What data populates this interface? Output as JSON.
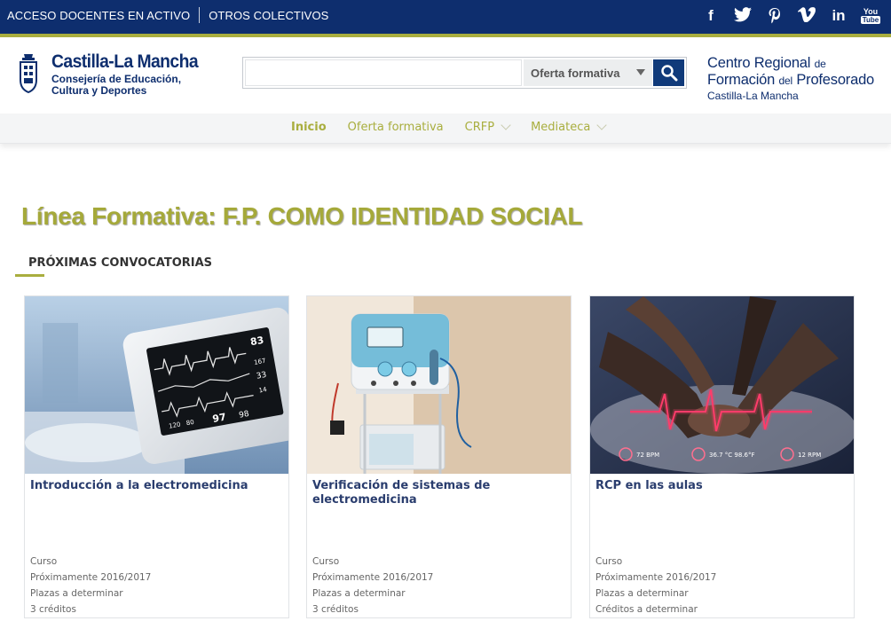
{
  "topbar": {
    "links": [
      "ACCESO DOCENTES EN ACTIVO",
      "OTROS COLECTIVOS"
    ],
    "social": [
      "facebook",
      "twitter",
      "pinterest",
      "vimeo",
      "linkedin",
      "youtube"
    ],
    "youtube_text": [
      "You",
      "Tube"
    ]
  },
  "brand": {
    "name": "Castilla-La Mancha",
    "sub_line1": "Consejería de Educación,",
    "sub_line2": "Cultura y Deportes"
  },
  "search": {
    "placeholder": "",
    "value": "",
    "select_value": "Oferta formativa"
  },
  "crfp": {
    "line1_main": "Centro Regional",
    "line1_small": "de",
    "line2_main": "Formación",
    "line2_small": "del",
    "line2_end": "Profesorado",
    "line3": "Castilla-La Mancha"
  },
  "nav": {
    "items": [
      {
        "label": "Inicio",
        "active": true
      },
      {
        "label": "Oferta formativa"
      },
      {
        "label": "CRFP",
        "has_dropdown": true
      },
      {
        "label": "Mediateca",
        "has_dropdown": true
      }
    ]
  },
  "page": {
    "title": "Línea Formativa: F.P. COMO IDENTIDAD SOCIAL",
    "section": "PRÓXIMAS CONVOCATORIAS"
  },
  "cards": [
    {
      "title": "Introducción a la electromedicina",
      "type": "Curso",
      "date": "Próximamente 2016/2017",
      "places": "Plazas a determinar",
      "credits": "3 créditos",
      "image": "medical-monitor-image",
      "monitor_values": [
        "83",
        "167",
        "33",
        "14",
        "120",
        "80",
        "97",
        "98"
      ]
    },
    {
      "title": "Verificación de sistemas de electromedicina",
      "type": "Curso",
      "date": "Próximamente 2016/2017",
      "places": "Plazas a determinar",
      "credits": "3 créditos",
      "image": "electrotherapy-device-image"
    },
    {
      "title": "RCP en las aulas",
      "type": "Curso",
      "date": "Próximamente 2016/2017",
      "places": "Plazas a determinar",
      "credits": "Créditos a determinar",
      "image": "cpr-image",
      "overlay": [
        "72 BPM",
        "36.7 °C 98.6°F",
        "12 RPM"
      ]
    }
  ],
  "colors": {
    "navy": "#0e2e6e",
    "olive": "#a9ae3f",
    "card_title": "#2a3d6e"
  }
}
